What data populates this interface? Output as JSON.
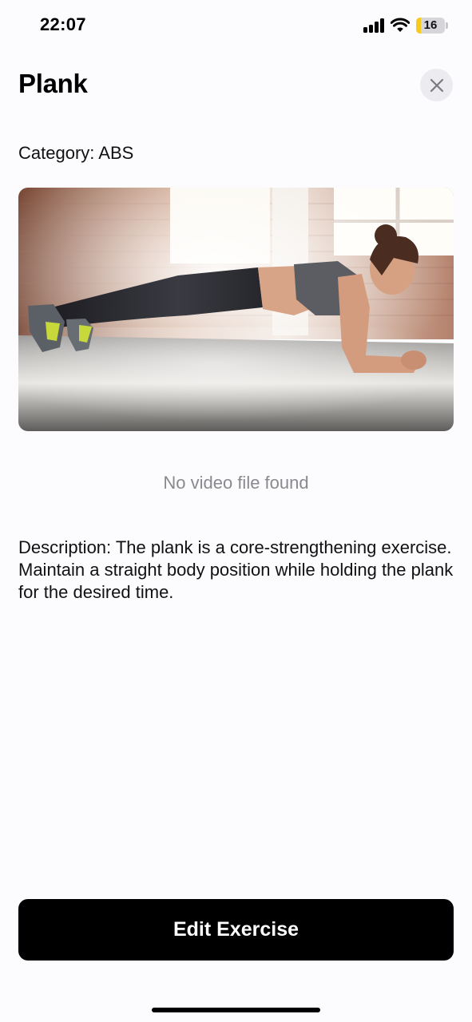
{
  "status_bar": {
    "time": "22:07",
    "battery_level": "16",
    "battery_fraction": 0.16,
    "icons": [
      "signal-icon",
      "wifi-icon",
      "battery-icon"
    ]
  },
  "header": {
    "title": "Plank",
    "close_icon": "close-icon"
  },
  "exercise": {
    "category": "Category: ABS",
    "image_alt": "woman-doing-plank-photo",
    "no_video_text": "No video file found",
    "description": "Description: The plank is a core-strengthening exercise. Maintain a straight body position while holding the plank for the desired time."
  },
  "actions": {
    "edit_label": "Edit Exercise"
  },
  "colors": {
    "background": "#fcfbfe",
    "primary_button": "#000000",
    "muted_text": "#8a8a8e",
    "battery_fill": "#f5cc1b"
  }
}
